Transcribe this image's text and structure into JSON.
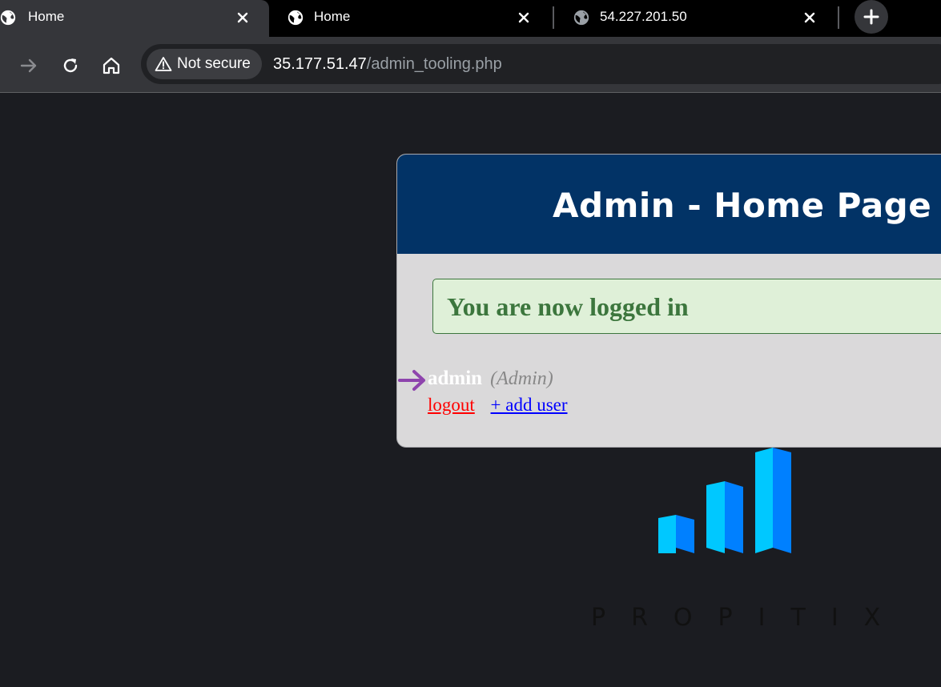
{
  "browser": {
    "tabs": [
      {
        "title": "Home",
        "active": true
      },
      {
        "title": "Home",
        "active": false
      },
      {
        "title": "54.227.201.50",
        "active": false
      }
    ],
    "new_tab_icon": "plus-icon",
    "toolbar": {
      "forward_icon": "forward-arrow-icon",
      "reload_icon": "reload-icon",
      "home_icon": "home-icon"
    },
    "security_label": "Not secure",
    "url_host": "35.177.51.47",
    "url_path": "/admin_tooling.php"
  },
  "page": {
    "header_title": "Admin - Home Page",
    "success_message": "You are now logged in",
    "user": {
      "name": "admin",
      "type": "(Admin)"
    },
    "links": {
      "logout": "logout",
      "add_user": "+ add user"
    },
    "logo_text": "PROPITIX"
  },
  "colors": {
    "page_bg": "#1b1c21",
    "header_bg": "#023366",
    "card_bg": "#dad9da",
    "success_bg": "#dff0d8",
    "success_text": "#3c763d",
    "logout": "#ff0000",
    "add_user": "#0000ff",
    "arrow": "#8e44ad",
    "logo_light": "#00c8ff",
    "logo_dark": "#0080ff"
  }
}
